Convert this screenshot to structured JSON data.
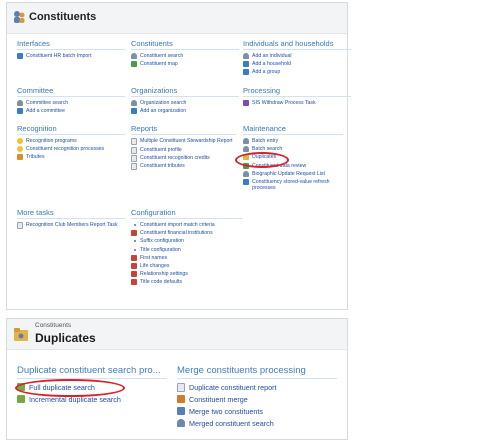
{
  "constituents_page": {
    "title": "Constituents",
    "sections": {
      "interfaces": {
        "heading": "Interfaces",
        "items": [
          "Constituent HR batch Import"
        ]
      },
      "constituents": {
        "heading": "Constituents",
        "items": [
          "Constituent search",
          "Constituent map"
        ]
      },
      "individuals": {
        "heading": "Individuals and households",
        "items": [
          "Add an individual",
          "Add a household",
          "Add a group"
        ]
      },
      "committee": {
        "heading": "Committee",
        "items": [
          "Committee search",
          "Add a committee"
        ]
      },
      "organizations": {
        "heading": "Organizations",
        "items": [
          "Organization search",
          "Add an organization"
        ]
      },
      "processing": {
        "heading": "Processing",
        "items": [
          "SIS Withdraw Process Task"
        ]
      },
      "recognition": {
        "heading": "Recognition",
        "items": [
          "Recognition programs",
          "Constituent recognition processes",
          "Tributes"
        ]
      },
      "reports": {
        "heading": "Reports",
        "items": [
          "Multiple Constituent Stewardship Report",
          "Constituent profile",
          "Constituent recognition credits",
          "Constituent tributes"
        ]
      },
      "maintenance": {
        "heading": "Maintenance",
        "items": [
          "Batch entry",
          "Batch search",
          "Duplicates",
          "Constituent data review",
          "Biographic Update Request List",
          "Constituency stored-value refresh processes"
        ]
      },
      "more_tasks": {
        "heading": "More tasks",
        "items": [
          "Recognition Club Members Report Task"
        ]
      },
      "configuration": {
        "heading": "Configuration",
        "items": [
          "Constituent import match criteria",
          "Constituent financial institutions",
          "Suffix configuration",
          "Title configuration",
          "First names",
          "Life changes",
          "Relationship settings",
          "Title code defaults"
        ]
      }
    }
  },
  "duplicates_page": {
    "breadcrumb": "Constituents",
    "title": "Duplicates",
    "search_section": {
      "heading": "Duplicate constituent search pro...",
      "items": [
        "Full duplicate search",
        "Incremental duplicate search"
      ]
    },
    "merge_section": {
      "heading": "Merge constituents processing",
      "items": [
        "Duplicate constituent report",
        "Constituent merge",
        "Merge two constituents",
        "Merged constituent search"
      ]
    }
  },
  "highlight_color": "#d8202a",
  "link_color": "#1f4e9c"
}
